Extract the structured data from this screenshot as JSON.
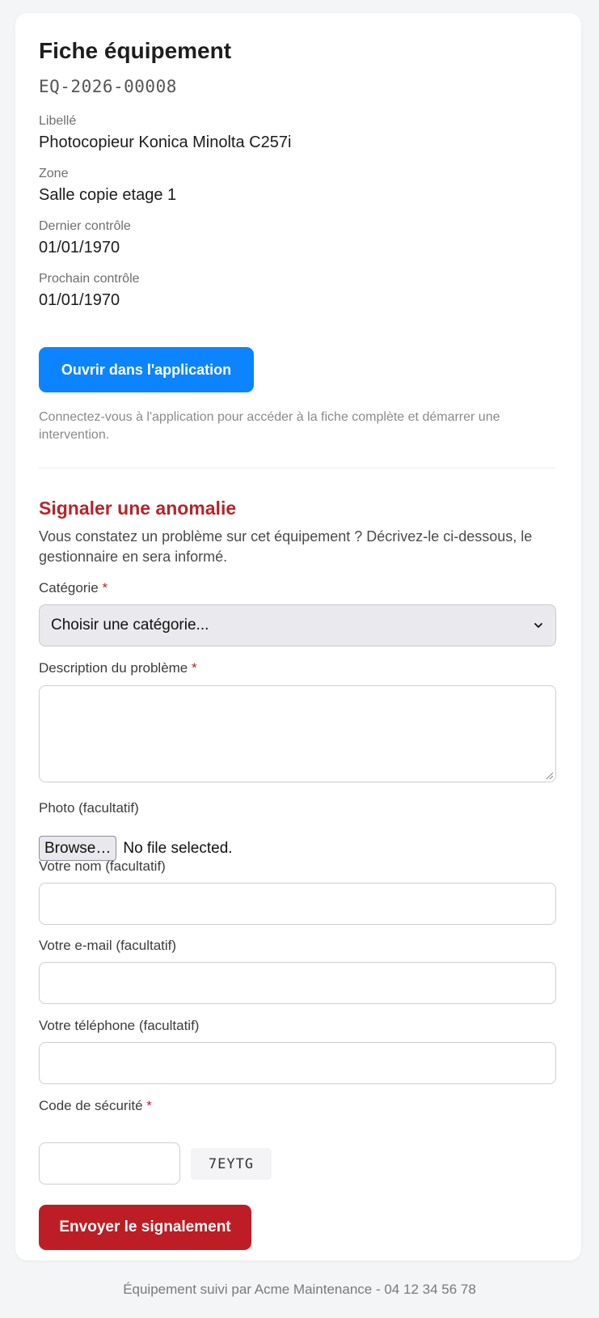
{
  "equipment": {
    "title": "Fiche équipement",
    "code": "EQ-2026-00008",
    "fields": [
      {
        "label": "Libellé",
        "value": "Photocopieur Konica Minolta C257i"
      },
      {
        "label": "Zone",
        "value": "Salle copie etage 1"
      },
      {
        "label": "Dernier contrôle",
        "value": "01/01/1970"
      },
      {
        "label": "Prochain contrôle",
        "value": "01/01/1970"
      }
    ],
    "open_app_label": "Ouvrir dans l'application",
    "hint": "Connectez-vous à l'application pour accéder à la fiche complète et démarrer une intervention."
  },
  "report": {
    "title": "Signaler une anomalie",
    "description": "Vous constatez un problème sur cet équipement ? Décrivez-le ci-dessous, le gestionnaire en sera informé.",
    "category": {
      "label": "Catégorie",
      "required_mark": "*",
      "selected": "Choisir une catégorie..."
    },
    "problem": {
      "label": "Description du problème",
      "required_mark": "*",
      "value": ""
    },
    "photo": {
      "label": "Photo (facultatif)",
      "browse_label": "Browse…",
      "status": "No file selected."
    },
    "name": {
      "label": "Votre nom (facultatif)",
      "value": ""
    },
    "email": {
      "label": "Votre e-mail (facultatif)",
      "value": ""
    },
    "phone": {
      "label": "Votre téléphone (facultatif)",
      "value": ""
    },
    "captcha": {
      "label": "Code de sécurité",
      "required_mark": "*",
      "code": "7EYTG",
      "value": ""
    },
    "submit_label": "Envoyer le signalement"
  },
  "footer": "Équipement suivi par Acme Maintenance - 04 12 34 56 78",
  "colors": {
    "primary": "#0d84ff",
    "danger": "#bd1d24",
    "section_title": "#b3262b",
    "background": "#f4f5f7"
  }
}
